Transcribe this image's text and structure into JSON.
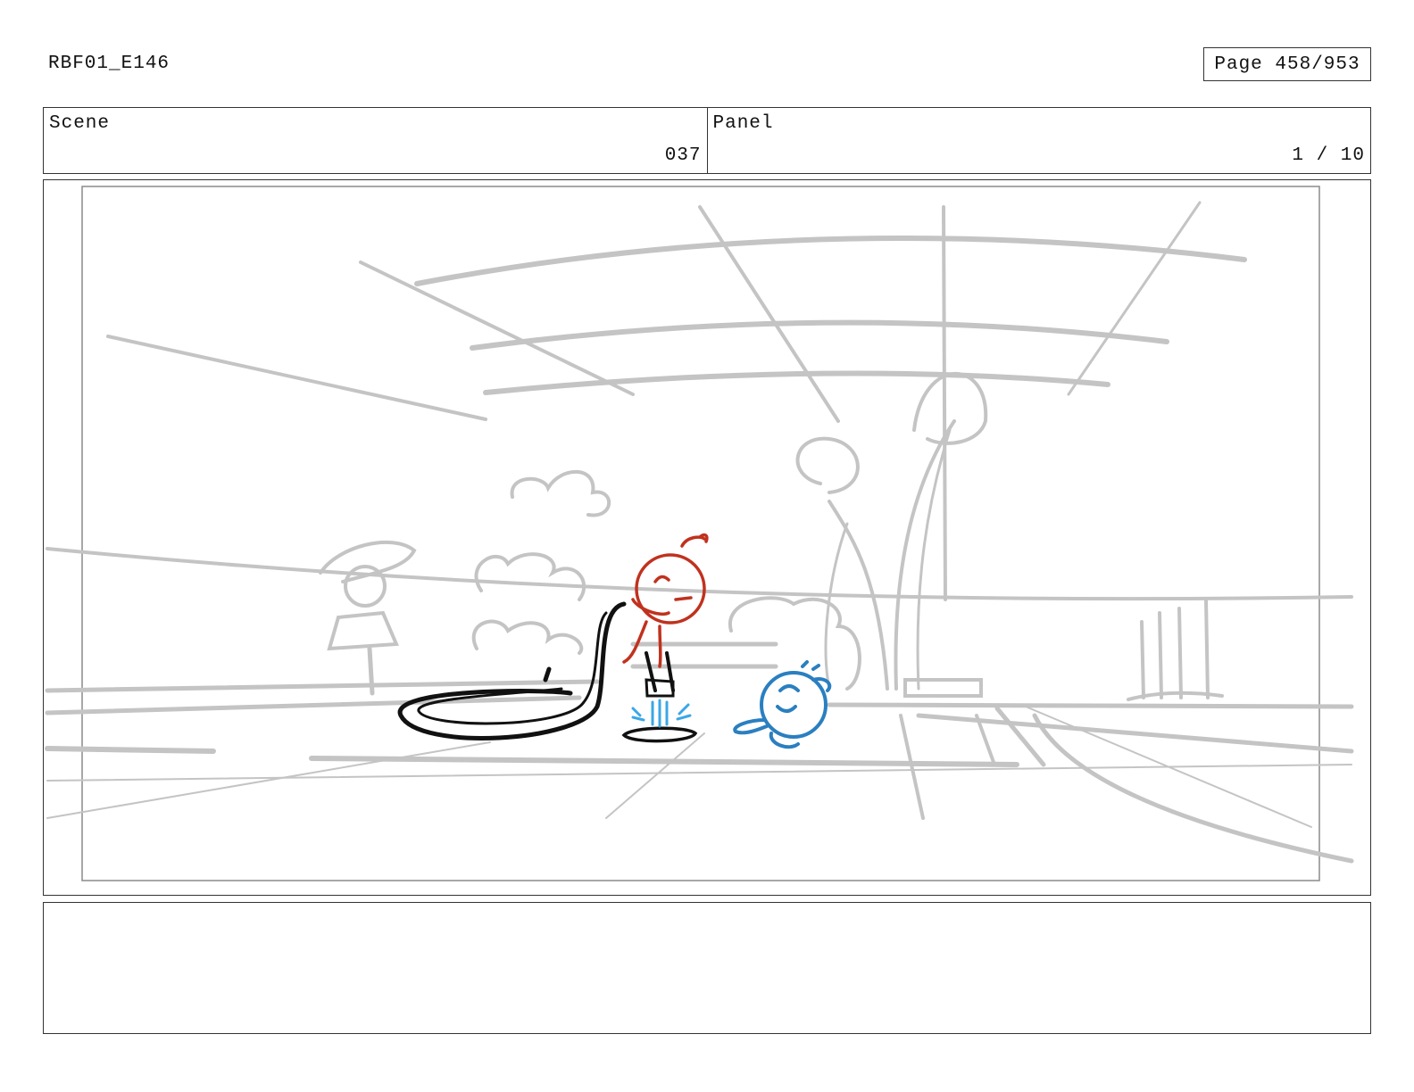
{
  "header": {
    "doc_id": "RBF01_E146",
    "page_label": "Page 458/953"
  },
  "info": {
    "scene_label": "Scene",
    "scene_value": "037",
    "panel_label": "Panel",
    "panel_value": "1 / 10"
  },
  "drawing": {
    "sketch_color": "#c4c4c4",
    "red_character_color": "#c0321e",
    "blue_character_color": "#2a7fc0",
    "water_color": "#3ba7e6",
    "hose_color": "#111111"
  },
  "notes": {
    "text": ""
  }
}
